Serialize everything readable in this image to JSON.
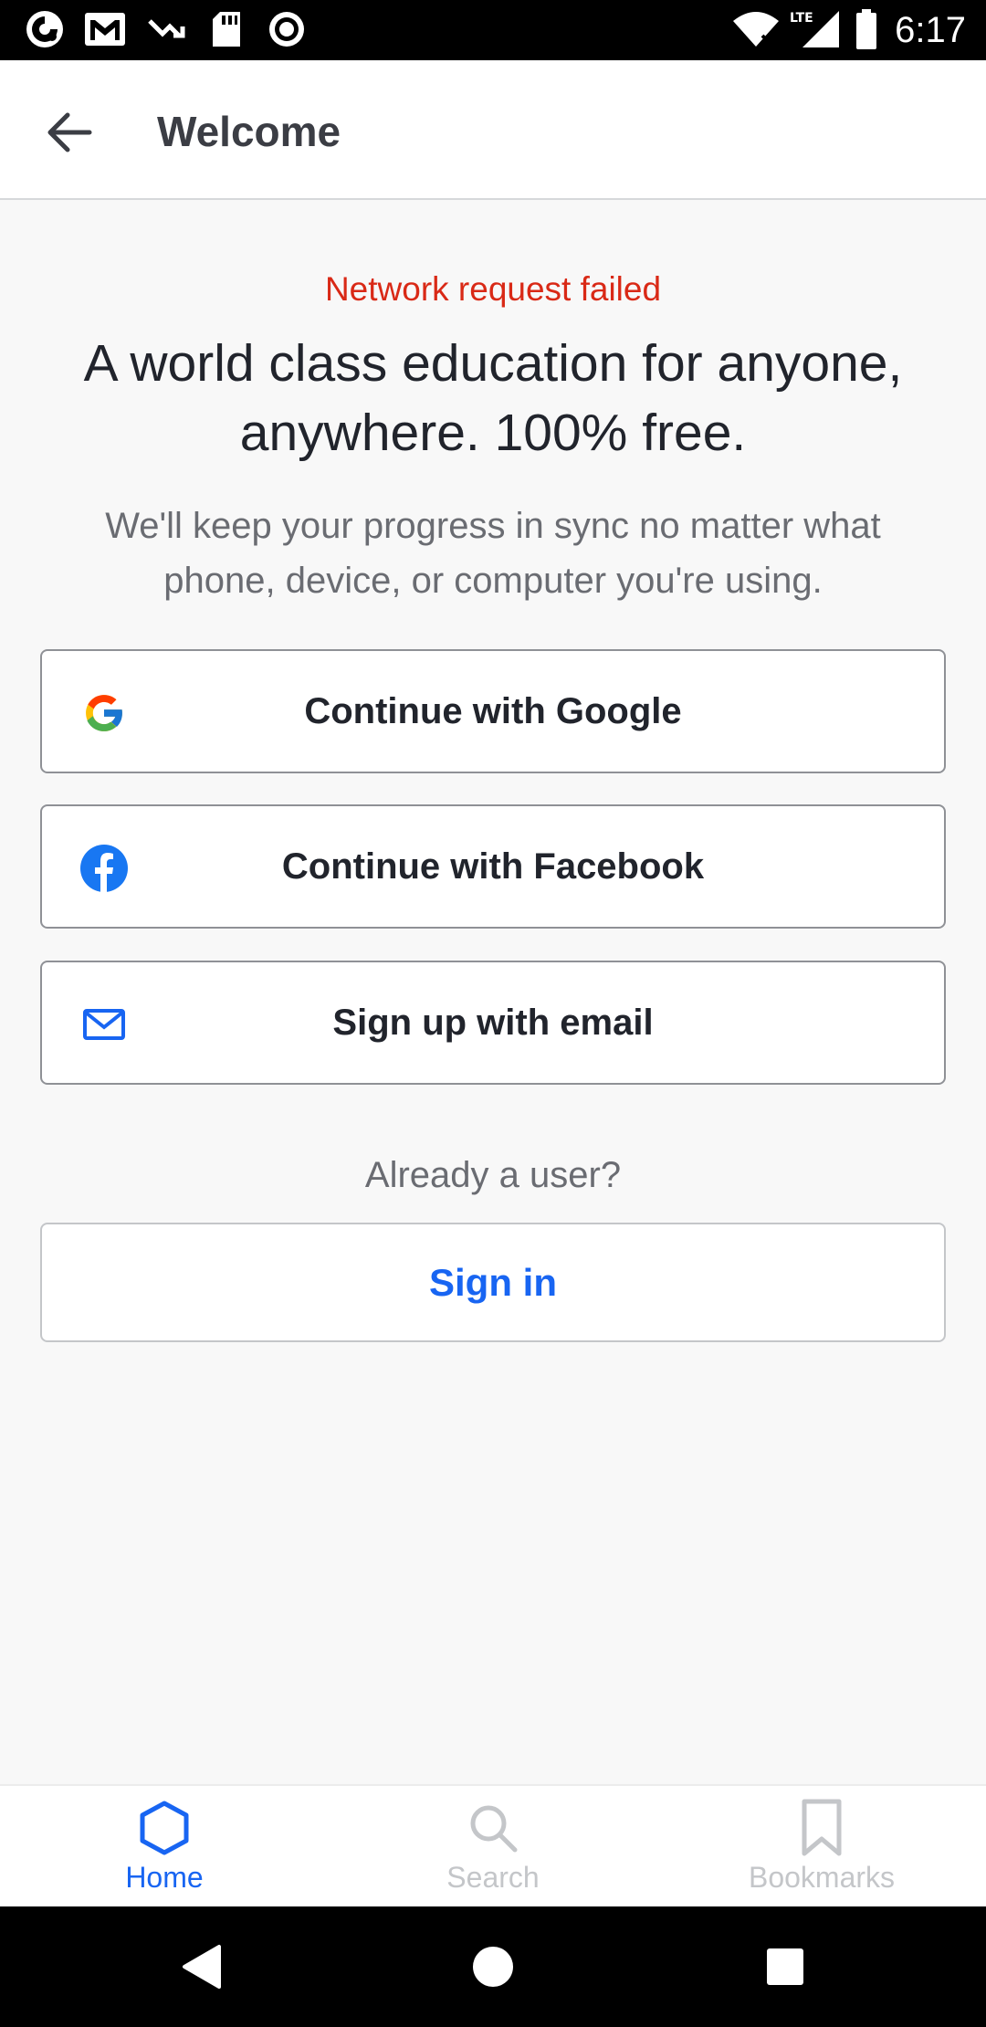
{
  "status_bar": {
    "time": "6:17",
    "left_icons": [
      "app-icon",
      "gmail-icon",
      "missed-call-icon",
      "sd-card-icon",
      "record-icon"
    ],
    "network_label": "LTE"
  },
  "app_bar": {
    "title": "Welcome"
  },
  "content": {
    "error": "Network request failed",
    "headline": "A world class education for anyone, anywhere. 100% free.",
    "subtext": "We'll keep your progress in sync no matter what phone, device, or computer you're using."
  },
  "buttons": {
    "google": "Continue with Google",
    "facebook": "Continue with Facebook",
    "email": "Sign up with email"
  },
  "already_user": "Already a user?",
  "sign_in": "Sign in",
  "tabs": [
    {
      "label": "Home",
      "icon": "hexagon-icon",
      "active": true
    },
    {
      "label": "Search",
      "icon": "search-icon",
      "active": false
    },
    {
      "label": "Bookmarks",
      "icon": "bookmark-icon",
      "active": false
    }
  ],
  "colors": {
    "accent": "#1865f2",
    "error": "#d92916",
    "facebook": "#1877f2",
    "inactive_tab": "#c4c6c9"
  }
}
